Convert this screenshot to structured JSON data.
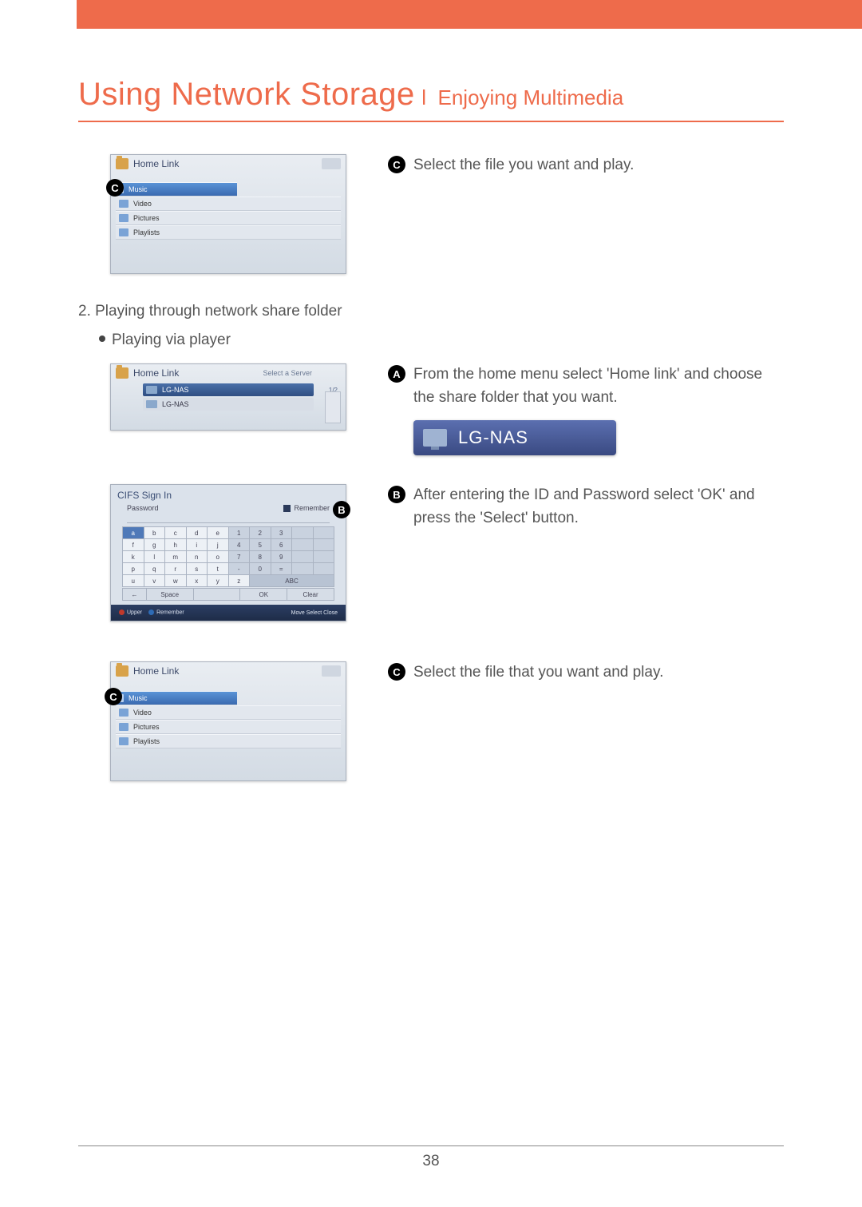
{
  "title_main": "Using Network Storage",
  "title_sub": "Enjoying Multimedia",
  "step_c_top": "Select the file you want and play.",
  "section2": "2. Playing through network share folder",
  "bullet_a": "Playing via player",
  "step_a": "From the home menu select 'Home link' and choose the share folder that you want.",
  "lgnas_label": "LG-NAS",
  "step_b": "After entering the ID and Password select 'OK' and press the 'Select' button.",
  "step_c_bottom": "Select the file that you want and play.",
  "page_number": "38",
  "shot_homelink": {
    "title": "Home Link",
    "items": [
      "Music",
      "Video",
      "Pictures",
      "Playlists"
    ]
  },
  "shot_server": {
    "title": "Home Link",
    "subtitle": "Select a Server",
    "page": "1/2",
    "rows": [
      "LG-NAS",
      "LG-NAS"
    ]
  },
  "shot_cifs": {
    "title": "CIFS Sign In",
    "field": "Password",
    "remember": "Remember",
    "keys_row1": [
      "a",
      "b",
      "c",
      "d",
      "e",
      "1",
      "2",
      "3"
    ],
    "keys_row2": [
      "f",
      "g",
      "h",
      "i",
      "j",
      "4",
      "5",
      "6"
    ],
    "keys_row3": [
      "k",
      "l",
      "m",
      "n",
      "o",
      "7",
      "8",
      "9"
    ],
    "keys_row4": [
      "p",
      "q",
      "r",
      "s",
      "t",
      "-",
      "0",
      "="
    ],
    "keys_row5": [
      "u",
      "v",
      "w",
      "x",
      "y",
      "z",
      "ABC"
    ],
    "bottom": [
      "←",
      "Space",
      "OK",
      "Clear"
    ],
    "footer_left_a": "Upper",
    "footer_left_b": "Remember",
    "footer_right": "Move    Select    Close"
  }
}
